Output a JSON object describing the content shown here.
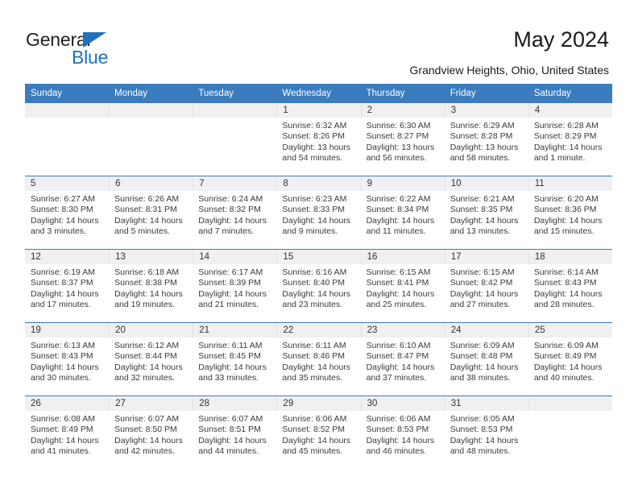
{
  "brand": {
    "name_top": "General",
    "name_bottom": "Blue",
    "accent_color": "#1f72bb"
  },
  "header": {
    "title": "May 2024",
    "location": "Grandview Heights, Ohio, United States",
    "header_bg": "#3a7cbd",
    "header_text_color": "#ffffff",
    "daynum_band_bg": "#f0f0f0"
  },
  "weekdays": [
    "Sunday",
    "Monday",
    "Tuesday",
    "Wednesday",
    "Thursday",
    "Friday",
    "Saturday"
  ],
  "weeks": [
    [
      {
        "day": "",
        "sunrise": "",
        "sunset": "",
        "daylight1": "",
        "daylight2": ""
      },
      {
        "day": "",
        "sunrise": "",
        "sunset": "",
        "daylight1": "",
        "daylight2": ""
      },
      {
        "day": "",
        "sunrise": "",
        "sunset": "",
        "daylight1": "",
        "daylight2": ""
      },
      {
        "day": "1",
        "sunrise": "Sunrise: 6:32 AM",
        "sunset": "Sunset: 8:26 PM",
        "daylight1": "Daylight: 13 hours",
        "daylight2": "and 54 minutes."
      },
      {
        "day": "2",
        "sunrise": "Sunrise: 6:30 AM",
        "sunset": "Sunset: 8:27 PM",
        "daylight1": "Daylight: 13 hours",
        "daylight2": "and 56 minutes."
      },
      {
        "day": "3",
        "sunrise": "Sunrise: 6:29 AM",
        "sunset": "Sunset: 8:28 PM",
        "daylight1": "Daylight: 13 hours",
        "daylight2": "and 58 minutes."
      },
      {
        "day": "4",
        "sunrise": "Sunrise: 6:28 AM",
        "sunset": "Sunset: 8:29 PM",
        "daylight1": "Daylight: 14 hours",
        "daylight2": "and 1 minute."
      }
    ],
    [
      {
        "day": "5",
        "sunrise": "Sunrise: 6:27 AM",
        "sunset": "Sunset: 8:30 PM",
        "daylight1": "Daylight: 14 hours",
        "daylight2": "and 3 minutes."
      },
      {
        "day": "6",
        "sunrise": "Sunrise: 6:26 AM",
        "sunset": "Sunset: 8:31 PM",
        "daylight1": "Daylight: 14 hours",
        "daylight2": "and 5 minutes."
      },
      {
        "day": "7",
        "sunrise": "Sunrise: 6:24 AM",
        "sunset": "Sunset: 8:32 PM",
        "daylight1": "Daylight: 14 hours",
        "daylight2": "and 7 minutes."
      },
      {
        "day": "8",
        "sunrise": "Sunrise: 6:23 AM",
        "sunset": "Sunset: 8:33 PM",
        "daylight1": "Daylight: 14 hours",
        "daylight2": "and 9 minutes."
      },
      {
        "day": "9",
        "sunrise": "Sunrise: 6:22 AM",
        "sunset": "Sunset: 8:34 PM",
        "daylight1": "Daylight: 14 hours",
        "daylight2": "and 11 minutes."
      },
      {
        "day": "10",
        "sunrise": "Sunrise: 6:21 AM",
        "sunset": "Sunset: 8:35 PM",
        "daylight1": "Daylight: 14 hours",
        "daylight2": "and 13 minutes."
      },
      {
        "day": "11",
        "sunrise": "Sunrise: 6:20 AM",
        "sunset": "Sunset: 8:36 PM",
        "daylight1": "Daylight: 14 hours",
        "daylight2": "and 15 minutes."
      }
    ],
    [
      {
        "day": "12",
        "sunrise": "Sunrise: 6:19 AM",
        "sunset": "Sunset: 8:37 PM",
        "daylight1": "Daylight: 14 hours",
        "daylight2": "and 17 minutes."
      },
      {
        "day": "13",
        "sunrise": "Sunrise: 6:18 AM",
        "sunset": "Sunset: 8:38 PM",
        "daylight1": "Daylight: 14 hours",
        "daylight2": "and 19 minutes."
      },
      {
        "day": "14",
        "sunrise": "Sunrise: 6:17 AM",
        "sunset": "Sunset: 8:39 PM",
        "daylight1": "Daylight: 14 hours",
        "daylight2": "and 21 minutes."
      },
      {
        "day": "15",
        "sunrise": "Sunrise: 6:16 AM",
        "sunset": "Sunset: 8:40 PM",
        "daylight1": "Daylight: 14 hours",
        "daylight2": "and 23 minutes."
      },
      {
        "day": "16",
        "sunrise": "Sunrise: 6:15 AM",
        "sunset": "Sunset: 8:41 PM",
        "daylight1": "Daylight: 14 hours",
        "daylight2": "and 25 minutes."
      },
      {
        "day": "17",
        "sunrise": "Sunrise: 6:15 AM",
        "sunset": "Sunset: 8:42 PM",
        "daylight1": "Daylight: 14 hours",
        "daylight2": "and 27 minutes."
      },
      {
        "day": "18",
        "sunrise": "Sunrise: 6:14 AM",
        "sunset": "Sunset: 8:43 PM",
        "daylight1": "Daylight: 14 hours",
        "daylight2": "and 28 minutes."
      }
    ],
    [
      {
        "day": "19",
        "sunrise": "Sunrise: 6:13 AM",
        "sunset": "Sunset: 8:43 PM",
        "daylight1": "Daylight: 14 hours",
        "daylight2": "and 30 minutes."
      },
      {
        "day": "20",
        "sunrise": "Sunrise: 6:12 AM",
        "sunset": "Sunset: 8:44 PM",
        "daylight1": "Daylight: 14 hours",
        "daylight2": "and 32 minutes."
      },
      {
        "day": "21",
        "sunrise": "Sunrise: 6:11 AM",
        "sunset": "Sunset: 8:45 PM",
        "daylight1": "Daylight: 14 hours",
        "daylight2": "and 33 minutes."
      },
      {
        "day": "22",
        "sunrise": "Sunrise: 6:11 AM",
        "sunset": "Sunset: 8:46 PM",
        "daylight1": "Daylight: 14 hours",
        "daylight2": "and 35 minutes."
      },
      {
        "day": "23",
        "sunrise": "Sunrise: 6:10 AM",
        "sunset": "Sunset: 8:47 PM",
        "daylight1": "Daylight: 14 hours",
        "daylight2": "and 37 minutes."
      },
      {
        "day": "24",
        "sunrise": "Sunrise: 6:09 AM",
        "sunset": "Sunset: 8:48 PM",
        "daylight1": "Daylight: 14 hours",
        "daylight2": "and 38 minutes."
      },
      {
        "day": "25",
        "sunrise": "Sunrise: 6:09 AM",
        "sunset": "Sunset: 8:49 PM",
        "daylight1": "Daylight: 14 hours",
        "daylight2": "and 40 minutes."
      }
    ],
    [
      {
        "day": "26",
        "sunrise": "Sunrise: 6:08 AM",
        "sunset": "Sunset: 8:49 PM",
        "daylight1": "Daylight: 14 hours",
        "daylight2": "and 41 minutes."
      },
      {
        "day": "27",
        "sunrise": "Sunrise: 6:07 AM",
        "sunset": "Sunset: 8:50 PM",
        "daylight1": "Daylight: 14 hours",
        "daylight2": "and 42 minutes."
      },
      {
        "day": "28",
        "sunrise": "Sunrise: 6:07 AM",
        "sunset": "Sunset: 8:51 PM",
        "daylight1": "Daylight: 14 hours",
        "daylight2": "and 44 minutes."
      },
      {
        "day": "29",
        "sunrise": "Sunrise: 6:06 AM",
        "sunset": "Sunset: 8:52 PM",
        "daylight1": "Daylight: 14 hours",
        "daylight2": "and 45 minutes."
      },
      {
        "day": "30",
        "sunrise": "Sunrise: 6:06 AM",
        "sunset": "Sunset: 8:53 PM",
        "daylight1": "Daylight: 14 hours",
        "daylight2": "and 46 minutes."
      },
      {
        "day": "31",
        "sunrise": "Sunrise: 6:05 AM",
        "sunset": "Sunset: 8:53 PM",
        "daylight1": "Daylight: 14 hours",
        "daylight2": "and 48 minutes."
      },
      {
        "day": "",
        "sunrise": "",
        "sunset": "",
        "daylight1": "",
        "daylight2": ""
      }
    ]
  ]
}
